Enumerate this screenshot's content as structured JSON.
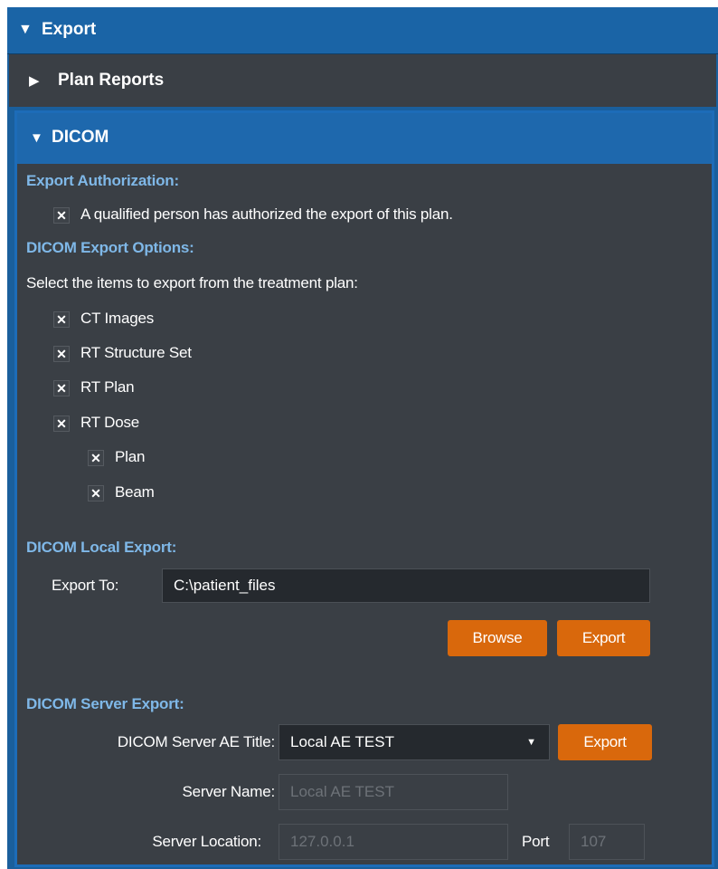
{
  "export_header": {
    "label": "Export",
    "icon": "triangle-down-icon"
  },
  "plan_reports": {
    "label": "Plan Reports",
    "icon": "triangle-right-icon"
  },
  "dicom": {
    "label": "DICOM",
    "icon": "triangle-down-icon",
    "auth": {
      "heading": "Export Authorization:",
      "checkbox_label": "A qualified person has authorized the export of this plan.",
      "checked": true
    },
    "options": {
      "heading": "DICOM Export Options:",
      "instruction": "Select the items to export from the treatment plan:",
      "items": [
        {
          "label": "CT Images",
          "checked": true
        },
        {
          "label": "RT Structure Set",
          "checked": true
        },
        {
          "label": "RT Plan",
          "checked": true
        },
        {
          "label": "RT Dose",
          "checked": true
        }
      ],
      "dose_items": [
        {
          "label": "Plan",
          "checked": true
        },
        {
          "label": "Beam",
          "checked": true
        }
      ]
    },
    "local": {
      "heading": "DICOM Local Export:",
      "export_to_label": "Export To:",
      "export_to_value": "C:\\patient_files",
      "browse_label": "Browse",
      "export_label": "Export"
    },
    "server": {
      "heading": "DICOM Server Export:",
      "ae_title_label": "DICOM Server AE Title:",
      "ae_title_value": "Local AE TEST",
      "export_label": "Export",
      "server_name_label": "Server Name:",
      "server_name_value": "Local AE TEST",
      "server_location_label": "Server Location:",
      "server_location_value": "127.0.0.1",
      "port_label": "Port",
      "port_value": "107"
    }
  },
  "colors": {
    "header_blue": "#1a64a6",
    "panel_gray": "#3a3f45",
    "section_heading": "#7fb8e8",
    "button_orange": "#d9680c"
  }
}
